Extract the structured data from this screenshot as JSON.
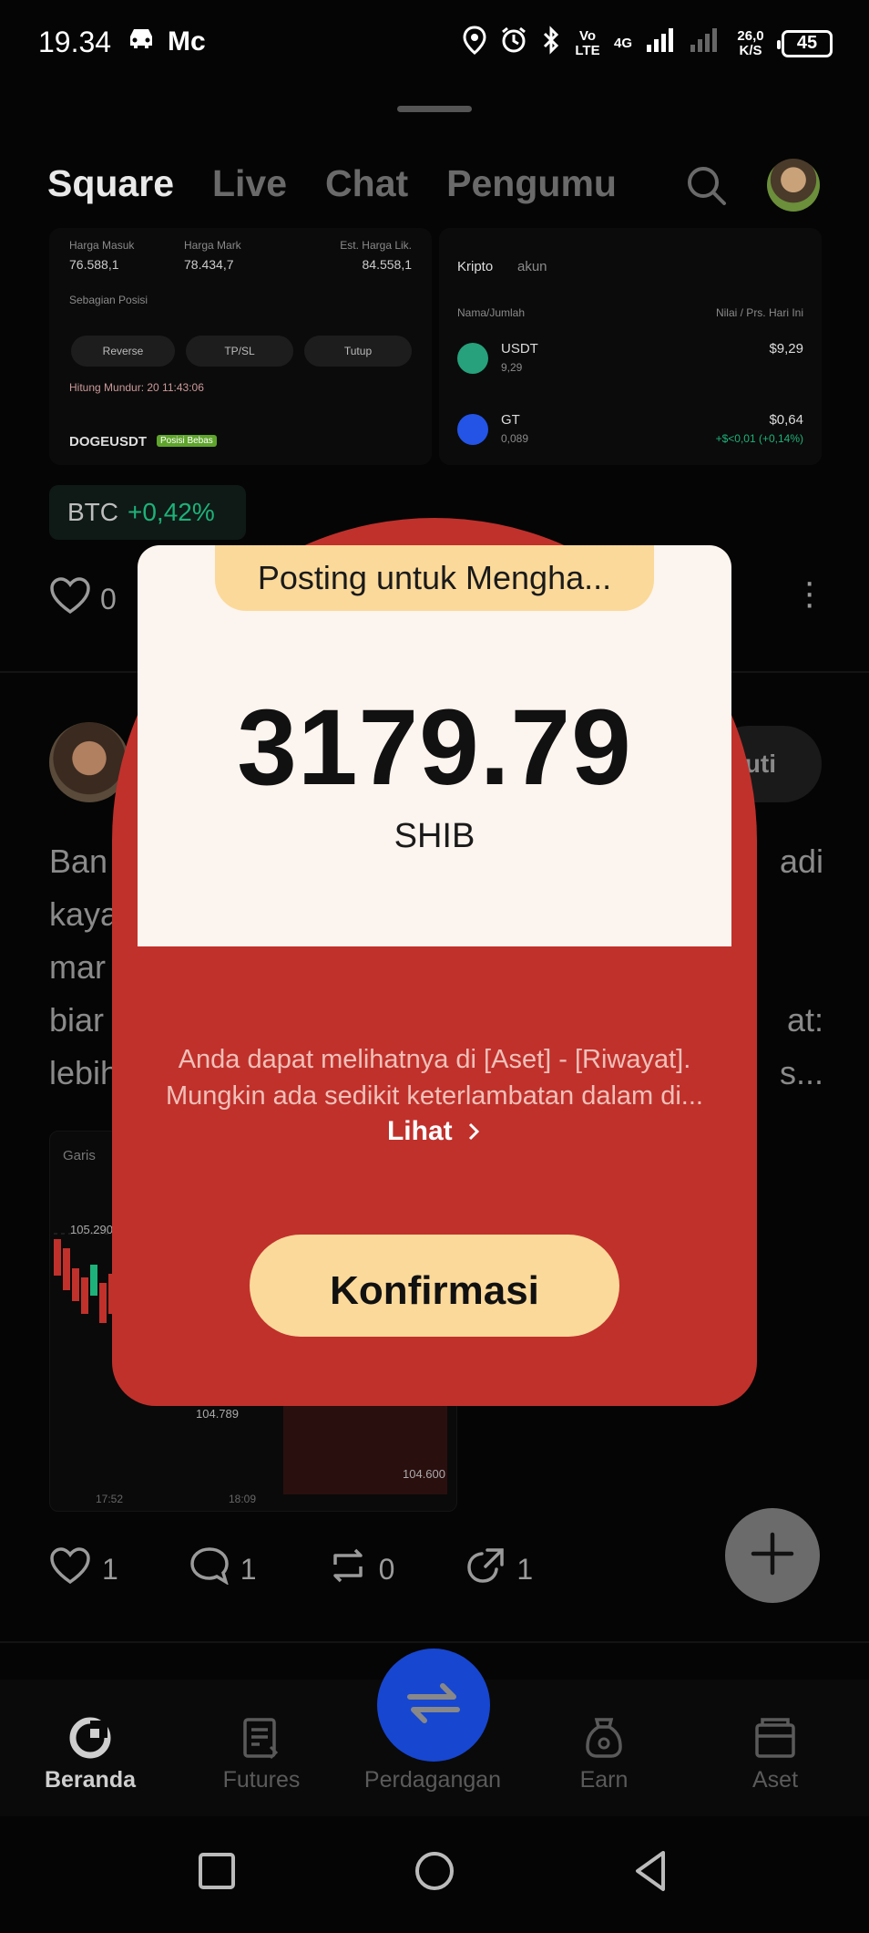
{
  "status_bar": {
    "time": "19.34",
    "carrier_short": "Mc",
    "volte": "Vo LTE",
    "network": "4G",
    "speed_value": "26,0",
    "speed_unit": "K/S",
    "battery": "45"
  },
  "header": {
    "tabs": [
      "Square",
      "Live",
      "Chat",
      "Pengumu"
    ],
    "active_tab": "Square"
  },
  "feed": {
    "thumb1": {
      "entry_label": "Harga Masuk",
      "entry_value": "76.588,1",
      "mark_label": "Harga Mark",
      "mark_value": "78.434,7",
      "liq_label": "Est. Harga Lik.",
      "liq_value": "84.558,1",
      "close_label": "Sebagian Posisi",
      "reverse": "Reverse",
      "tpsl": "TP/SL",
      "close": "Tutup",
      "countdown": "Hitung Mundur: 20 11:43:06",
      "pair": "DOGEUSDT",
      "badge": "Posisi Bebas"
    },
    "thumb2": {
      "tab1": "Kripto",
      "tab2": "akun",
      "col_left": "Nama/Jumlah",
      "col_right": "Nilai / Prs. Hari Ini",
      "coins": [
        {
          "symbol": "USDT",
          "amount": "9,29",
          "value": "$9,29"
        },
        {
          "symbol": "GT",
          "amount": "0,089",
          "value": "$0,64",
          "change": "+$<0,01 (+0,14%)"
        }
      ]
    },
    "ticker_chip": {
      "symbol": "BTC",
      "change": "+0,42%"
    },
    "post1_likes": "0",
    "post2": {
      "follow_label": "uti",
      "text_lines": [
        {
          "left": "Ban",
          "right": "adi"
        },
        {
          "left": "kaya",
          "right": ""
        },
        {
          "left": "mar",
          "right": ""
        },
        {
          "left": "biar",
          "right": "at:"
        },
        {
          "left": "lebih",
          "right": "s..."
        }
      ],
      "chart": {
        "label": "Garis",
        "price_high": "105.290",
        "price_low": "104.789",
        "price_right": "104.600",
        "time1": "17:52",
        "time2": "18:09"
      },
      "likes": "1",
      "comments": "1",
      "reposts": "0",
      "shares": "1"
    }
  },
  "bottom_nav": [
    {
      "label": "Beranda",
      "active": true
    },
    {
      "label": "Futures",
      "active": false
    },
    {
      "label": "Perdagangan",
      "active": false
    },
    {
      "label": "Earn",
      "active": false
    },
    {
      "label": "Aset",
      "active": false
    }
  ],
  "modal": {
    "title": "Posting untuk Mengha...",
    "amount": "3179.79",
    "currency": "SHIB",
    "info_line1": "Anda dapat melihatnya di [Aset] - [Riwayat].",
    "info_line2": "Mungkin ada sedikit keterlambatan dalam di...",
    "view_label": "Lihat",
    "confirm_label": "Konfirmasi",
    "colors": {
      "envelope": "#c0312c",
      "card": "#fcf4ee",
      "accent": "#fbd99a"
    }
  }
}
